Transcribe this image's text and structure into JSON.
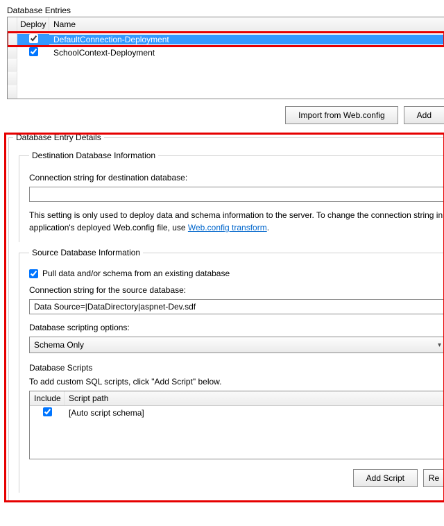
{
  "entries": {
    "title": "Database Entries",
    "columns": {
      "deploy": "Deploy",
      "name": "Name"
    },
    "rows": [
      {
        "deploy": true,
        "name": "DefaultConnection-Deployment",
        "selected": true,
        "highlight": true
      },
      {
        "deploy": true,
        "name": "SchoolContext-Deployment",
        "selected": false,
        "highlight": false
      }
    ],
    "buttons": {
      "import": "Import from Web.config",
      "add": "Add"
    }
  },
  "details": {
    "title": "Database Entry Details",
    "dest": {
      "title": "Destination Database Information",
      "conn_label": "Connection string for destination database:",
      "conn_value": "",
      "note_before": "This setting is only used to deploy data and schema information to the server. To change the connection string in application's deployed Web.config file, use ",
      "note_link": "Web.config transform",
      "note_after": "."
    },
    "source": {
      "title": "Source Database Information",
      "pull_label": "Pull data and/or schema from an existing database",
      "pull_checked": true,
      "conn_label": "Connection string for the source database:",
      "conn_value": "Data Source=|DataDirectory|aspnet-Dev.sdf",
      "opts_label": "Database scripting options:",
      "opts_value": "Schema Only",
      "scripts_title": "Database Scripts",
      "scripts_note": "To add custom SQL scripts, click \"Add Script\" below.",
      "scripts_columns": {
        "include": "Include",
        "path": "Script path"
      },
      "scripts_rows": [
        {
          "include": true,
          "path": "[Auto script schema]"
        }
      ],
      "buttons": {
        "add_script": "Add Script",
        "remove": "Re"
      }
    }
  }
}
